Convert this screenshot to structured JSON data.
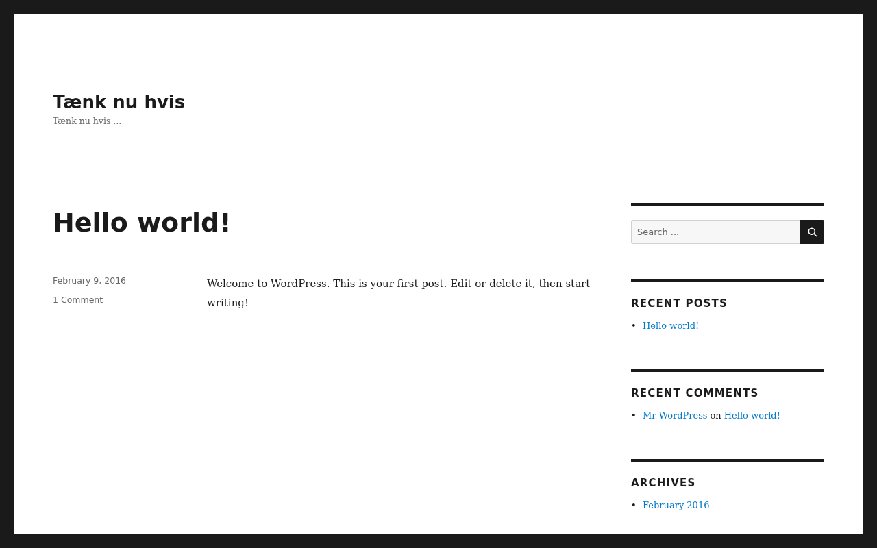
{
  "site": {
    "title": "Tænk nu hvis",
    "tagline": "Tænk nu hvis ..."
  },
  "post": {
    "title": "Hello world!",
    "date": "February 9, 2016",
    "comments": "1 Comment",
    "body": "Welcome to WordPress. This is your first post. Edit or delete it, then start writing!"
  },
  "sidebar": {
    "search": {
      "placeholder": "Search ..."
    },
    "widgets": [
      {
        "title": "RECENT POSTS",
        "items": [
          [
            {
              "text": "•",
              "kind": "marker"
            },
            {
              "text": "Hello world!",
              "kind": "link"
            }
          ]
        ]
      },
      {
        "title": "RECENT COMMENTS",
        "items": [
          [
            {
              "text": "•",
              "kind": "marker"
            },
            {
              "text": "Mr WordPress",
              "kind": "link"
            },
            {
              "text": "on",
              "kind": "text"
            },
            {
              "text": "Hello world!",
              "kind": "link"
            }
          ]
        ]
      },
      {
        "title": "ARCHIVES",
        "items": [
          [
            {
              "text": "•",
              "kind": "marker"
            },
            {
              "text": "February 2016",
              "kind": "link"
            }
          ]
        ]
      }
    ]
  }
}
